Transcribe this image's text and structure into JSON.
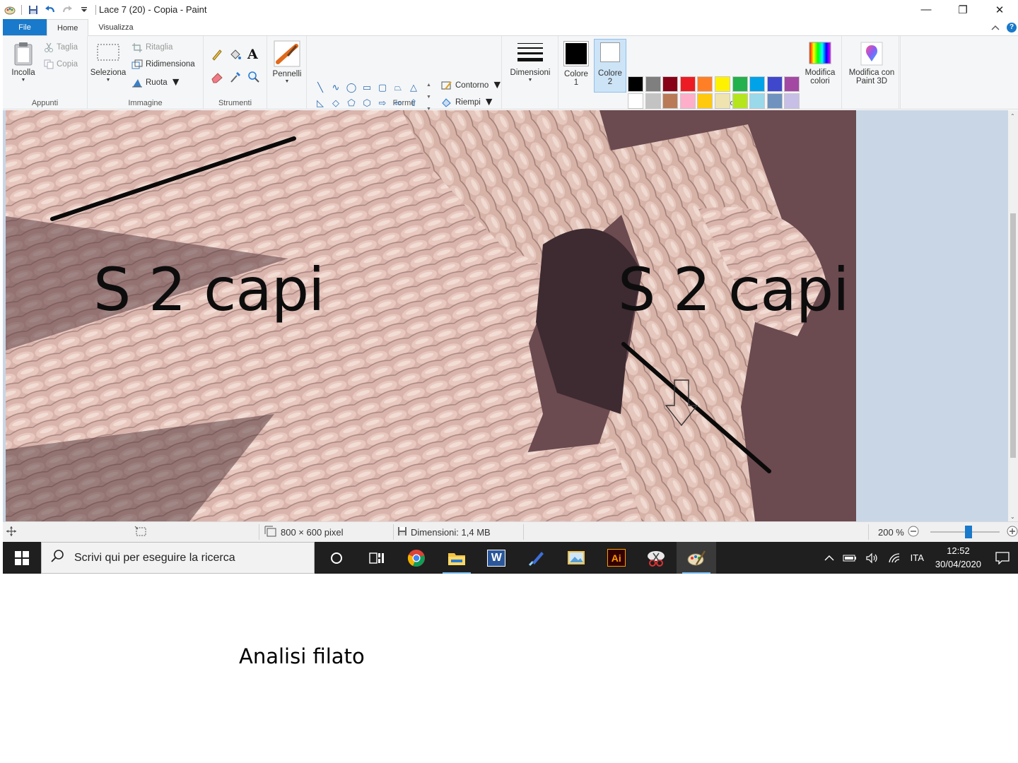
{
  "window": {
    "title": "Lace 7 (20) - Copia - Paint",
    "minimize_glyph": "—",
    "restore_glyph": "❐",
    "close_glyph": "✕"
  },
  "tabs": {
    "file": "File",
    "home": "Home",
    "view": "Visualizza"
  },
  "ribbon": {
    "clipboard": {
      "group": "Appunti",
      "paste": "Incolla",
      "cut": "Taglia",
      "copy": "Copia"
    },
    "image": {
      "group": "Immagine",
      "select": "Seleziona",
      "crop": "Ritaglia",
      "resize": "Ridimensiona",
      "rotate": "Ruota"
    },
    "tools": {
      "group": "Strumenti"
    },
    "brushes": {
      "label": "Pennelli"
    },
    "shapes": {
      "group": "Forme",
      "outline": "Contorno",
      "fill": "Riempi"
    },
    "size": {
      "label": "Dimensioni"
    },
    "colors": {
      "group": "Colori",
      "color1_line1": "Colore",
      "color1_line2": "1",
      "color2_line1": "Colore",
      "color2_line2": "2",
      "edit_line1": "Modifica",
      "edit_line2": "colori",
      "paint3d_line1": "Modifica con",
      "paint3d_line2": "Paint 3D",
      "palette_row1": [
        "#000000",
        "#7f7f7f",
        "#880015",
        "#ed1c24",
        "#ff7f27",
        "#fff200",
        "#22b14c",
        "#00a2e8",
        "#3f48cc",
        "#a349a4"
      ],
      "palette_row2": [
        "#ffffff",
        "#c3c3c3",
        "#b97a57",
        "#ffaec9",
        "#ffc90e",
        "#efe4b0",
        "#b5e61d",
        "#99d9ea",
        "#7092be",
        "#c8bfe7"
      ],
      "palette_row3": [
        "#ffffff",
        "#ffffff",
        "#ffffff",
        "#ffffff",
        "#ffffff",
        "#ffffff",
        "#ffffff",
        "#ffffff",
        "#ffffff",
        "#ffffff"
      ]
    }
  },
  "canvas": {
    "label_left": "S 2 capi",
    "label_right": "S 2 capi"
  },
  "status": {
    "image_size": "800 × 600 pixel",
    "file_size": "Dimensioni: 1,4 MB",
    "zoom": "200 %"
  },
  "taskbar": {
    "search_placeholder": "Scrivi qui per eseguire la ricerca",
    "ai_label": "Ai",
    "word_label": "W",
    "language": "ITA",
    "time": "12:52",
    "date": "30/04/2020"
  },
  "caption": "Analisi filato"
}
